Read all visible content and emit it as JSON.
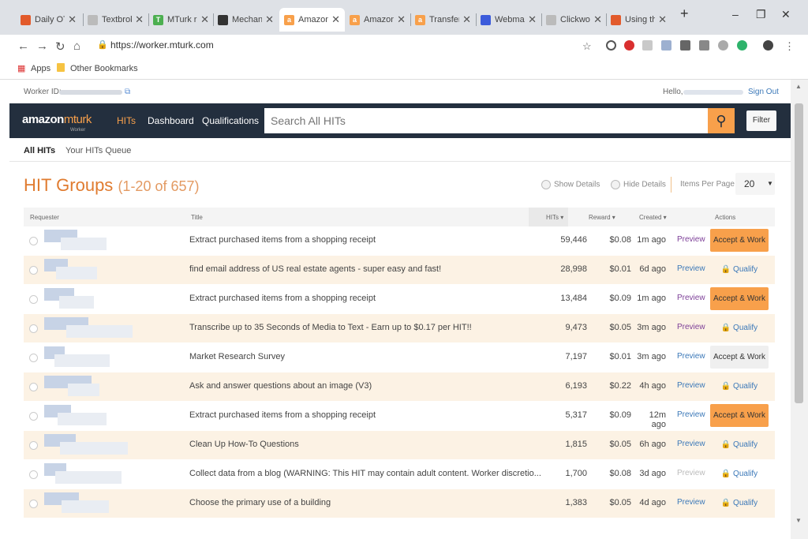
{
  "browser": {
    "tabs": [
      {
        "label": "Daily OT",
        "fav": "#e25a2b",
        "glyph": ""
      },
      {
        "label": "Textbroker",
        "fav": "#bbb",
        "glyph": ""
      },
      {
        "label": "MTurk rev",
        "fav": "#4caf50",
        "glyph": "T"
      },
      {
        "label": "Mechanic",
        "fav": "#333",
        "glyph": ""
      },
      {
        "label": "Amazon",
        "fav": "#f8a04b",
        "glyph": "a"
      },
      {
        "label": "Amazon",
        "fav": "#f8a04b",
        "glyph": "a"
      },
      {
        "label": "Transfer",
        "fav": "#f8a04b",
        "glyph": "a"
      },
      {
        "label": "Webmail",
        "fav": "#3b5bdb",
        "glyph": ""
      },
      {
        "label": "Clickworker",
        "fav": "#bbb",
        "glyph": ""
      },
      {
        "label": "Using the",
        "fav": "#e25a2b",
        "glyph": ""
      }
    ],
    "url": "https://worker.mturk.com",
    "bookmarks": {
      "apps": "Apps",
      "other": "Other Bookmarks"
    }
  },
  "topbar": {
    "worker_id_label": "Worker ID:",
    "hello": "Hello,",
    "sign_out": "Sign Out"
  },
  "nav": {
    "logo_main": "amazon",
    "logo_accent": "mturk",
    "logo_sub": "Worker",
    "links": [
      "HITs",
      "Dashboard",
      "Qualifications"
    ],
    "search_placeholder": "Search All HITs",
    "filter": "Filter",
    "accent": "#f8a04b",
    "navbg": "#232f3e"
  },
  "subnav": {
    "all": "All HITs",
    "queue": "Your HITs Queue"
  },
  "heading": {
    "title": "HIT Groups",
    "count": "(1-20 of 657)"
  },
  "controls": {
    "show": "Show Details",
    "hide": "Hide Details",
    "ipp_label": "Items Per Page",
    "ipp_value": "20"
  },
  "columns": {
    "requester": "Requester",
    "title": "Title",
    "hits": "HITs ▾",
    "reward": "Reward ▾",
    "created": "Created ▾",
    "actions": "Actions"
  },
  "rows": [
    {
      "title": "Extract purchased items from a shopping receipt",
      "hits": "59,446",
      "reward": "$0.08",
      "created": "1m ago",
      "preview": "Preview",
      "action": "Accept & Work",
      "action_type": "orange",
      "preview_style": "purple"
    },
    {
      "title": "find email address of US real estate agents - super easy and fast!",
      "hits": "28,998",
      "reward": "$0.01",
      "created": "6d ago",
      "preview": "Preview",
      "action": "🔒 Qualify",
      "action_type": "qual",
      "preview_style": "blue"
    },
    {
      "title": "Extract purchased items from a shopping receipt",
      "hits": "13,484",
      "reward": "$0.09",
      "created": "1m ago",
      "preview": "Preview",
      "action": "Accept & Work",
      "action_type": "orange",
      "preview_style": "purple"
    },
    {
      "title": "Transcribe up to 35 Seconds of Media to Text - Earn up to $0.17 per HIT!!",
      "hits": "9,473",
      "reward": "$0.05",
      "created": "3m ago",
      "preview": "Preview",
      "action": "🔒 Qualify",
      "action_type": "qual",
      "preview_style": "purple"
    },
    {
      "title": "Market Research Survey",
      "hits": "7,197",
      "reward": "$0.01",
      "created": "3m ago",
      "preview": "Preview",
      "action": "Accept & Work",
      "action_type": "gray",
      "preview_style": "blue"
    },
    {
      "title": "Ask and answer questions about an image (V3)",
      "hits": "6,193",
      "reward": "$0.22",
      "created": "4h ago",
      "preview": "Preview",
      "action": "🔒 Qualify",
      "action_type": "qual",
      "preview_style": "blue"
    },
    {
      "title": "Extract purchased items from a shopping receipt",
      "hits": "5,317",
      "reward": "$0.09",
      "created": "12m ago",
      "preview": "Preview",
      "action": "Accept & Work",
      "action_type": "orange",
      "preview_style": "blue"
    },
    {
      "title": "Clean Up How-To Questions",
      "hits": "1,815",
      "reward": "$0.05",
      "created": "6h ago",
      "preview": "Preview",
      "action": "🔒 Qualify",
      "action_type": "qual",
      "preview_style": "blue"
    },
    {
      "title": "Collect data from a blog (WARNING: This HIT may contain adult content. Worker discretio...",
      "hits": "1,700",
      "reward": "$0.08",
      "created": "3d ago",
      "preview": "Preview",
      "action": "🔒 Qualify",
      "action_type": "qual",
      "preview_style": "dis"
    },
    {
      "title": "Choose the primary use of a building",
      "hits": "1,383",
      "reward": "$0.05",
      "created": "4d ago",
      "preview": "Preview",
      "action": "🔒 Qualify",
      "action_type": "qual",
      "preview_style": "blue"
    }
  ]
}
